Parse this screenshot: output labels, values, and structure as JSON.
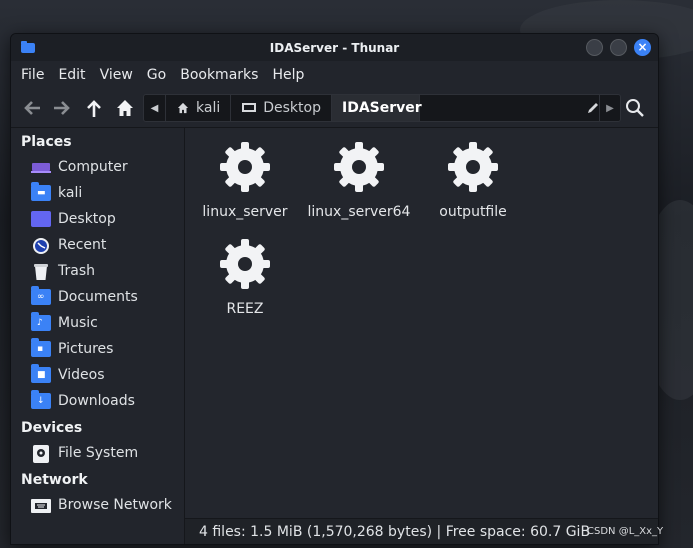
{
  "window": {
    "title": "IDAServer - Thunar",
    "close_glyph": "×"
  },
  "menubar": {
    "items": [
      "File",
      "Edit",
      "View",
      "Go",
      "Bookmarks",
      "Help"
    ]
  },
  "toolbar": {
    "icons": [
      "back-arrow-icon",
      "forward-arrow-icon",
      "up-arrow-icon",
      "home-icon",
      "search-icon"
    ]
  },
  "pathbar": {
    "segments": [
      {
        "label": "kali",
        "icon": "home-icon"
      },
      {
        "label": "Desktop",
        "icon": "desktop-icon"
      },
      {
        "label": "IDAServer",
        "icon": ""
      }
    ]
  },
  "sidebar": {
    "places_header": "Places",
    "places": [
      {
        "label": "Computer",
        "icon": "computer-icon"
      },
      {
        "label": "kali",
        "icon": "home-folder-icon"
      },
      {
        "label": "Desktop",
        "icon": "desktop-folder-icon"
      },
      {
        "label": "Recent",
        "icon": "recent-icon"
      },
      {
        "label": "Trash",
        "icon": "trash-icon"
      },
      {
        "label": "Documents",
        "icon": "documents-folder-icon"
      },
      {
        "label": "Music",
        "icon": "music-folder-icon"
      },
      {
        "label": "Pictures",
        "icon": "pictures-folder-icon"
      },
      {
        "label": "Videos",
        "icon": "videos-folder-icon"
      },
      {
        "label": "Downloads",
        "icon": "downloads-folder-icon"
      }
    ],
    "devices_header": "Devices",
    "devices": [
      {
        "label": "File System",
        "icon": "drive-icon"
      }
    ],
    "network_header": "Network",
    "network": [
      {
        "label": "Browse Network",
        "icon": "network-icon"
      }
    ]
  },
  "files": [
    {
      "name": "linux_server",
      "icon": "executable-gear-icon"
    },
    {
      "name": "linux_server64",
      "icon": "executable-gear-icon"
    },
    {
      "name": "outputfile",
      "icon": "executable-gear-icon"
    },
    {
      "name": "REEZ",
      "icon": "executable-gear-icon"
    }
  ],
  "statusbar": {
    "text": "4 files: 1.5 MiB (1,570,268 bytes)  |  Free space: 60.7 GiB"
  },
  "watermark": "CSDN @L_Xx_Y",
  "colors": {
    "accent": "#3b82f6",
    "window_bg": "#22252c",
    "content_bg": "#23262d",
    "text": "#e6e8eb"
  }
}
